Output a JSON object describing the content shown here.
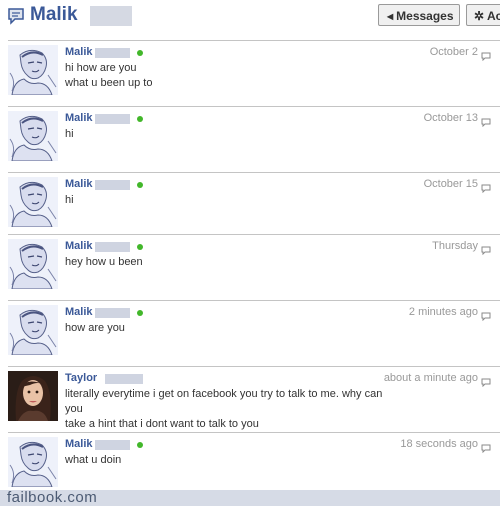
{
  "header": {
    "name": "Malik",
    "messages_button": "Messages",
    "actions_button": "Ac"
  },
  "messages": [
    {
      "sender": "Malik",
      "time": "October 2",
      "lines": [
        "hi how are you",
        "what u been up to"
      ]
    },
    {
      "sender": "Malik",
      "time": "October 13",
      "lines": [
        "hi"
      ]
    },
    {
      "sender": "Malik",
      "time": "October 15",
      "lines": [
        "hi"
      ]
    },
    {
      "sender": "Malik",
      "time": "Thursday",
      "lines": [
        "hey how u been"
      ]
    },
    {
      "sender": "Malik",
      "time": "2 minutes ago",
      "lines": [
        "how are you"
      ]
    },
    {
      "sender": "Taylor",
      "time": "about a minute ago",
      "lines": [
        "literally everytime i get on facebook you try to talk to me. why can you",
        "take a hint that i dont want to talk to you"
      ]
    },
    {
      "sender": "Malik",
      "time": "18 seconds ago",
      "lines": [
        "what u doin"
      ]
    }
  ],
  "footer": {
    "watermark": "failbook.com"
  },
  "colors": {
    "link": "#3b5998",
    "online": "#42b72a",
    "footer": "#d6dbe6"
  }
}
